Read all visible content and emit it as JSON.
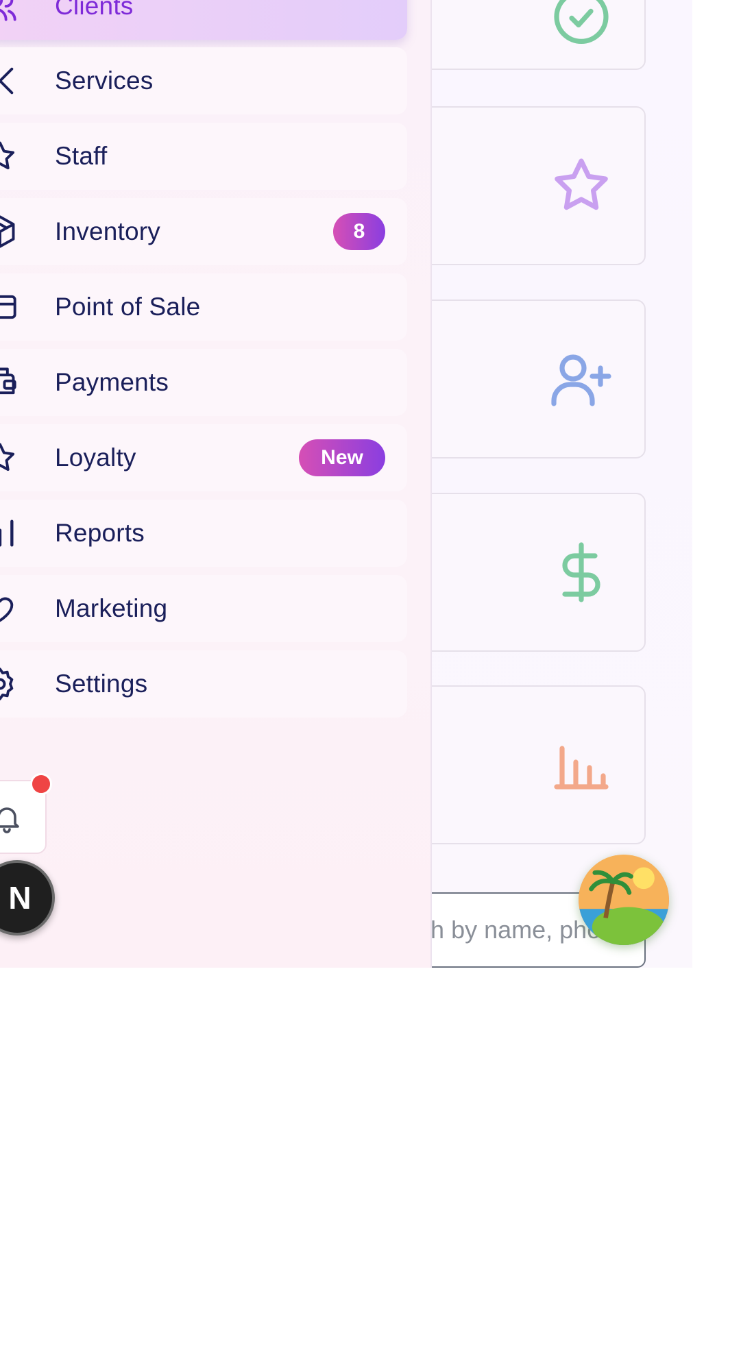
{
  "sidebar": {
    "items": [
      {
        "label": "Clients",
        "icon": "users-icon",
        "active": true
      },
      {
        "label": "Services",
        "icon": "scissors-icon"
      },
      {
        "label": "Staff",
        "icon": "star-icon"
      },
      {
        "label": "Inventory",
        "icon": "box-icon",
        "badge": "8"
      },
      {
        "label": "Point of Sale",
        "icon": "credit-card-icon"
      },
      {
        "label": "Payments",
        "icon": "wallet-icon"
      },
      {
        "label": "Loyalty",
        "icon": "star-icon",
        "badge": "New"
      },
      {
        "label": "Reports",
        "icon": "bar-chart-icon"
      },
      {
        "label": "Marketing",
        "icon": "heart-icon"
      },
      {
        "label": "Settings",
        "icon": "gear-icon"
      }
    ],
    "avatar_initial": "N"
  },
  "cards": [
    {
      "icon": "check-circle-icon",
      "color": "#7ccba0"
    },
    {
      "icon": "star-icon",
      "color": "#c9a0f0"
    },
    {
      "icon": "user-plus-icon",
      "color": "#8aa6e6"
    },
    {
      "icon": "dollar-icon",
      "color": "#7ccba0"
    },
    {
      "icon": "bar-chart-icon",
      "color": "#f3a88a"
    }
  ],
  "search": {
    "placeholder": "Search by name, phone, email, or..."
  },
  "colors": {
    "active_text": "#7e2ad8",
    "nav_text": "#1a1f5a",
    "badge_gradient_start": "#d64fb5",
    "badge_gradient_end": "#8a3ee0",
    "notification_dot": "#ef4444"
  }
}
